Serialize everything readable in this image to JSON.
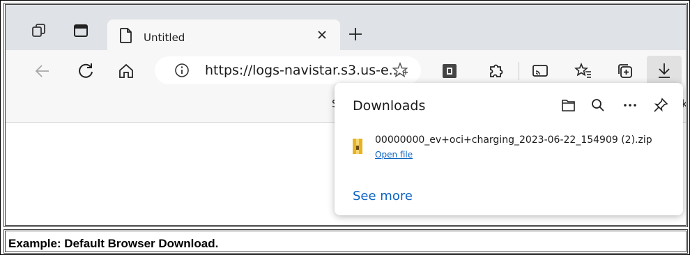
{
  "browser": {
    "tab": {
      "title": "Untitled"
    },
    "address": {
      "url": "https://logs-navistar.s3.us-e..."
    },
    "favorites_bar": {
      "left_fragment": "S",
      "right_fragment": "k"
    }
  },
  "downloads": {
    "title": "Downloads",
    "item": {
      "filename": "00000000_ev+oci+charging_2023-06-22_154909 (2).zip",
      "action": "Open file",
      "icon": "zip-folder-icon"
    },
    "see_more": "See more"
  },
  "caption": "Example:  Default Browser Download.",
  "colors": {
    "link": "#0b63c4",
    "tabstrip": "#dfe2e6",
    "toolbar": "#f7f7f7",
    "zip_icon": "#e8b321"
  }
}
